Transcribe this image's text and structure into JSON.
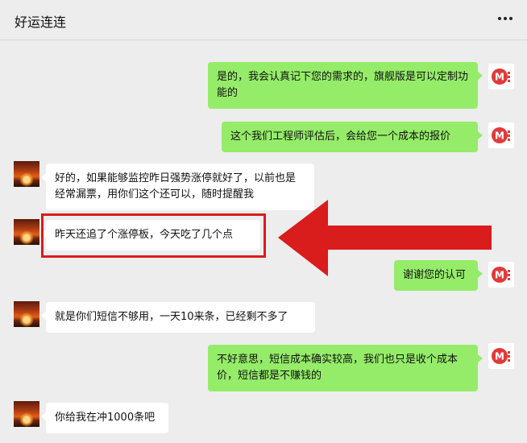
{
  "header": {
    "title": "好运连连",
    "menu_icon": "more-dots-icon"
  },
  "colors": {
    "sent_bubble": "#95ec69",
    "received_bubble": "#ffffff",
    "annotation": "#d91c1c"
  },
  "messages": [
    {
      "side": "right",
      "text": "是的，我会认真记下您的需求的，旗舰版是可以定制功能的"
    },
    {
      "side": "right",
      "text": "这个我们工程师评估后，会给您一个成本的报价"
    },
    {
      "side": "left",
      "text": "好的，如果能够监控昨日强势涨停就好了，以前也是经常漏票，用你们这个还可以，随时提醒我"
    },
    {
      "side": "left",
      "text": "昨天还追了个涨停板，今天吃了几个点"
    },
    {
      "side": "right",
      "text": "谢谢您的认可"
    },
    {
      "side": "left",
      "text": "就是你们短信不够用，一天10来条，已经剩不多了"
    },
    {
      "side": "right",
      "text": "不好意思，短信成本确实较高，我们也只是收个成本价，短信都是不赚钱的"
    },
    {
      "side": "left",
      "text": "你给我在冲1000条吧"
    }
  ],
  "annotation": {
    "icon": "red-arrow-left-icon"
  }
}
